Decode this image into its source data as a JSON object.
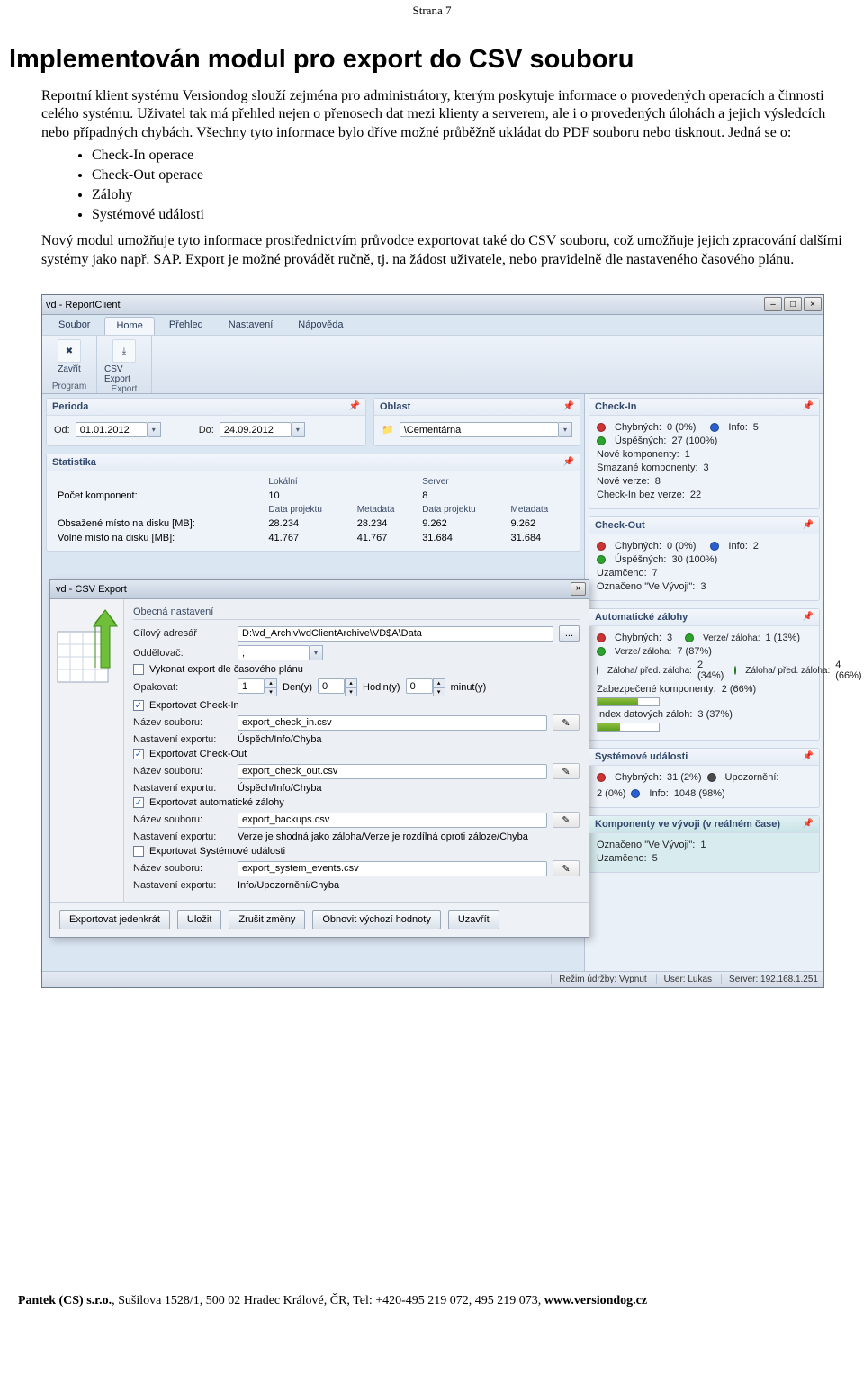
{
  "page_header": "Strana 7",
  "doc": {
    "h1": "Implementován modul pro export do CSV souboru",
    "p1": "Reportní klient systému Versiondog slouží zejména pro administrátory, kterým poskytuje informace o provedených operacích a činnosti celého systému. Uživatel tak má přehled nejen o přenosech dat mezi klienty a serverem, ale i o provedených úlohách a jejich výsledcích nebo případných chybách. Všechny tyto informace bylo dříve možné průběžně ukládat do PDF souboru nebo tisknout. Jedná se o:",
    "bullets": [
      "Check-In operace",
      "Check-Out operace",
      "Zálohy",
      "Systémové události"
    ],
    "p2": "Nový modul umožňuje tyto informace prostřednictvím průvodce exportovat také do CSV souboru, což umožňuje jejich zpracování dalšími systémy jako např. SAP. Export je možné provádět ručně, tj. na žádost uživatele, nebo pravidelně dle nastaveného časového plánu."
  },
  "app": {
    "title": "vd - ReportClient",
    "tabs": {
      "t1": "Soubor",
      "t2": "Home",
      "t3": "Přehled",
      "t4": "Nastavení",
      "t5": "Nápověda"
    },
    "ribbon": {
      "close": "Zavřít",
      "csv": "CSV Export",
      "g1": "Program",
      "g2": "Export"
    },
    "perioda": {
      "title": "Perioda",
      "od_lbl": "Od:",
      "od_val": "01.01.2012",
      "do_lbl": "Do:",
      "do_val": "24.09.2012"
    },
    "oblast": {
      "title": "Oblast",
      "value": "\\Cementárna"
    },
    "stat": {
      "title": "Statistika",
      "col_local": "Lokální",
      "col_server": "Server",
      "row_komp": "Počet komponent:",
      "komp_l": "10",
      "komp_s": "8",
      "sub_dp": "Data projektu",
      "sub_md": "Metadata",
      "row_obs": "Obsažené místo na disku [MB]:",
      "obs_l_dp": "28.234",
      "obs_l_md": "28.234",
      "obs_s_dp": "9.262",
      "obs_s_md": "9.262",
      "row_vol": "Volné místo na disku [MB]:",
      "vol_l_dp": "41.767",
      "vol_l_md": "41.767",
      "vol_s_dp": "31.684",
      "vol_s_md": "31.684"
    },
    "checkin": {
      "title": "Check-In",
      "chyb_lbl": "Chybných:",
      "chyb_val": "0 (0%)",
      "info_lbl": "Info:",
      "info_val": "5",
      "usp_lbl": "Úspěšných:",
      "usp_val": "27 (100%)",
      "nove_lbl": "Nové komponenty:",
      "nove_val": "1",
      "smaz_lbl": "Smazané komponenty:",
      "smaz_val": "3",
      "verze_lbl": "Nové verze:",
      "verze_val": "8",
      "bez_lbl": "Check-In bez verze:",
      "bez_val": "22"
    },
    "checkout": {
      "title": "Check-Out",
      "chyb_lbl": "Chybných:",
      "chyb_val": "0 (0%)",
      "info_lbl": "Info:",
      "info_val": "2",
      "usp_lbl": "Úspěšných:",
      "usp_val": "30 (100%)",
      "uzam_lbl": "Uzamčeno:",
      "uzam_val": "7",
      "ozn_lbl": "Označeno \"Ve Vývoji\":",
      "ozn_val": "3"
    },
    "zalohy": {
      "title": "Automatické zálohy",
      "chyb_lbl": "Chybných:",
      "chyb_val": "3",
      "vz_lbl": "Verze/ záloha:",
      "vz_val": "1 (13%)",
      "vz2_lbl": "Verze/ záloha:",
      "vz2_val": "7 (87%)",
      "zp_lbl": "Záloha/ před. záloha:",
      "zp_val": "2 (34%)",
      "zp2_lbl": "Záloha/ před. záloha:",
      "zp2_val": "4 (66%)",
      "zab_lbl": "Zabezpečené komponenty:",
      "zab_val": "2 (66%)",
      "idx_lbl": "Index datových záloh:",
      "idx_val": "3 (37%)"
    },
    "sysu": {
      "title": "Systémové události",
      "chyb_lbl": "Chybných:",
      "chyb_val": "31 (2%)",
      "upz_lbl": "Upozornění:",
      "upz_val": "2 (0%)",
      "info_lbl": "Info:",
      "info_val": "1048 (98%)"
    },
    "komp": {
      "title": "Komponenty ve vývoji (v reálném čase)",
      "ozn_lbl": "Označeno \"Ve Vývoji\":",
      "ozn_val": "1",
      "uzam_lbl": "Uzamčeno:",
      "uzam_val": "5"
    },
    "status": {
      "rezim": "Režim údržby: Vypnut",
      "user": "User: Lukas",
      "server": "Server: 192.168.1.251"
    }
  },
  "modal": {
    "title": "vd - CSV Export",
    "section": "Obecná nastavení",
    "dir_lbl": "Cílový adresář",
    "dir_val": "D:\\vd_Archiv\\vdClientArchive\\VD$A\\Data",
    "dir_btn": "...",
    "sep_lbl": "Oddělovač:",
    "sep_val": ";",
    "plan_chk": "Vykonat export dle časového plánu",
    "opak_lbl": "Opakovat:",
    "den_val": "1",
    "den_lbl": "Den(y)",
    "hod_val": "0",
    "hod_lbl": "Hodin(y)",
    "min_val": "0",
    "min_lbl": "minut(y)",
    "chk_ci": "Exportovat Check-In",
    "file_lbl": "Název souboru:",
    "set_lbl": "Nastavení exportu:",
    "ci_file": "export_check_in.csv",
    "ci_set": "Úspěch/Info/Chyba",
    "chk_co": "Exportovat Check-Out",
    "co_file": "export_check_out.csv",
    "co_set": "Úspěch/Info/Chyba",
    "chk_bk": "Exportovat automatické zálohy",
    "bk_file": "export_backups.csv",
    "bk_set": "Verze je shodná jako záloha/Verze je rozdílná oproti záloze/Chyba",
    "chk_sy": "Exportovat Systémové události",
    "sy_file": "export_system_events.csv",
    "sy_set": "Info/Upozornění/Chyba",
    "b1": "Exportovat jedenkrát",
    "b2": "Uložit",
    "b3": "Zrušit změny",
    "b4": "Obnovit výchozí hodnoty",
    "b5": "Uzavřít"
  },
  "footer": {
    "company": "Pantek (CS) s.r.o.",
    "rest": ", Sušilova 1528/1, 500 02 Hradec Králové, ČR, Tel: +420-495 219 072, 495 219 073, ",
    "url": "www.versiondog.cz"
  }
}
